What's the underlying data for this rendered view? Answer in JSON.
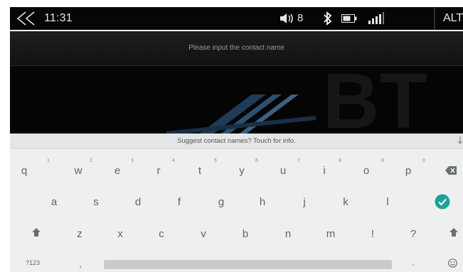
{
  "status_bar": {
    "back_icon": "back-chevron-icon",
    "time": "11:31",
    "volume_icon": "volume-icon",
    "volume_level": "8",
    "bluetooth_icon": "bluetooth-icon",
    "battery_icon": "battery-icon",
    "signal_icon": "signal-icon",
    "keyboard_mode": "ALT"
  },
  "input": {
    "placeholder": "Please input the contact name"
  },
  "background": {
    "logo_text": "BT"
  },
  "keyboard": {
    "suggestion_bar": "Suggest contact names? Touch for info.",
    "row1": [
      {
        "key": "q",
        "num": "1"
      },
      {
        "key": "w",
        "num": "2"
      },
      {
        "key": "e",
        "num": "3"
      },
      {
        "key": "r",
        "num": "4"
      },
      {
        "key": "t",
        "num": "5"
      },
      {
        "key": "y",
        "num": "6"
      },
      {
        "key": "u",
        "num": "7"
      },
      {
        "key": "i",
        "num": "8"
      },
      {
        "key": "o",
        "num": "9"
      },
      {
        "key": "p",
        "num": "0"
      }
    ],
    "row2": [
      "a",
      "s",
      "d",
      "f",
      "g",
      "h",
      "j",
      "k",
      "l"
    ],
    "row3": [
      "z",
      "x",
      "c",
      "v",
      "b",
      "n",
      "m",
      "!",
      "?"
    ],
    "bottom_left": "?123",
    "comma": ",",
    "period": ".",
    "icons": {
      "backspace": "backspace-icon",
      "enter": "enter-check-icon",
      "shift": "shift-icon",
      "emoji": "emoji-icon"
    },
    "colors": {
      "enter_green": "#1da29a",
      "background": "#eef0f0"
    }
  }
}
